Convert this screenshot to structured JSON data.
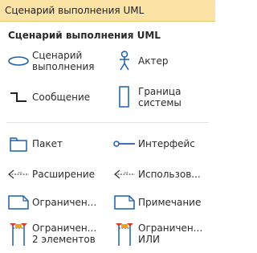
{
  "window": {
    "title": "Сценарий выполнения UML"
  },
  "section": {
    "title": "Сценарий выполнения UML"
  },
  "shapes": [
    {
      "label_line1": "Сценарий",
      "label_line2": "выполнения",
      "icon": "use-case-icon"
    },
    {
      "label_line1": "Актер",
      "label_line2": "",
      "icon": "actor-icon"
    },
    {
      "label_line1": "Сообщение",
      "label_line2": "",
      "icon": "message-connector-icon"
    },
    {
      "label_line1": "Граница",
      "label_line2": "системы",
      "icon": "system-boundary-icon"
    },
    {
      "label_line1": "Пакет",
      "label_line2": "",
      "icon": "package-icon"
    },
    {
      "label_line1": "Интерфейс",
      "label_line2": "",
      "icon": "interface-icon"
    },
    {
      "label_line1": "Расширение",
      "label_line2": "",
      "icon": "extend-icon"
    },
    {
      "label_line1": "Использов...",
      "label_line2": "",
      "icon": "include-icon"
    },
    {
      "label_line1": "Ограничен...",
      "label_line2": "",
      "icon": "constraint-icon"
    },
    {
      "label_line1": "Примечание",
      "label_line2": "",
      "icon": "note-icon"
    },
    {
      "label_line1": "Ограничен...",
      "label_line2": "2 элементов",
      "icon": "constraint-two-elements-icon"
    },
    {
      "label_line1": "Ограничен...",
      "label_line2": "ИЛИ",
      "icon": "constraint-or-icon"
    }
  ],
  "colors": {
    "stencil_blue": "#1f5fa8",
    "title_bar": "#fbe3a6",
    "orange": "#f0a020"
  }
}
